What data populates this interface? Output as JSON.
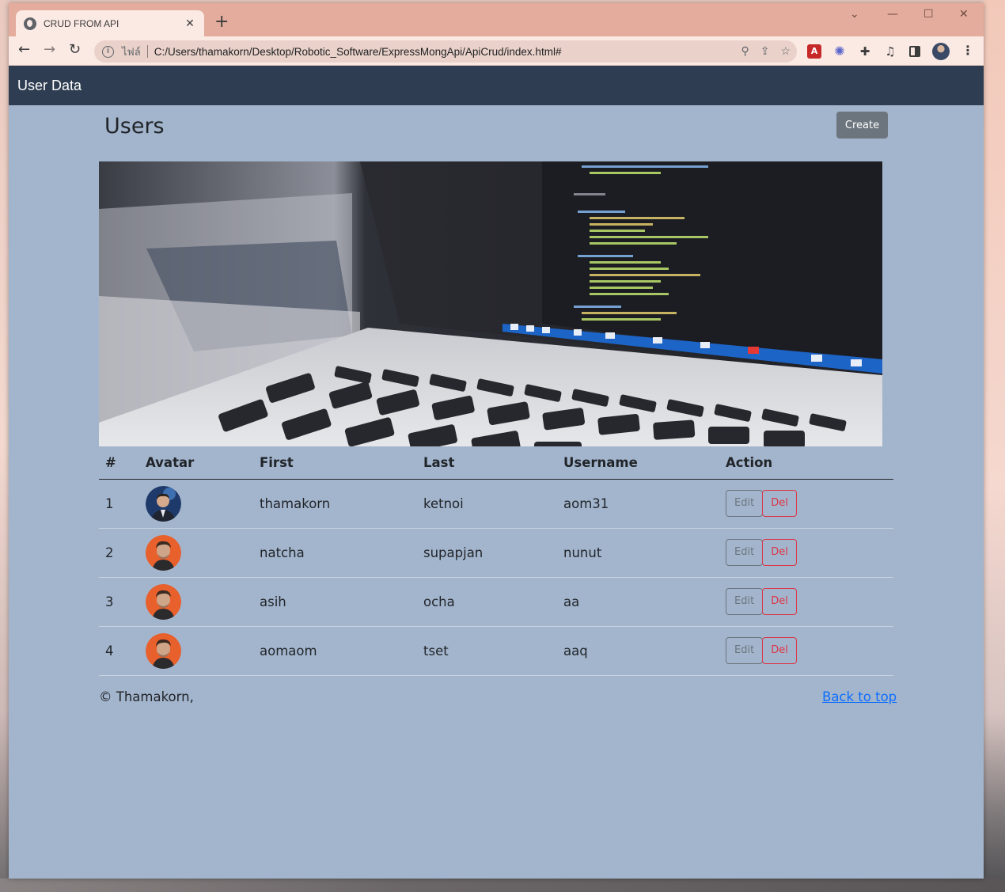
{
  "browser": {
    "tab_title": "CRUD FROM API",
    "new_tab": "+",
    "scheme_label": "ไฟล์",
    "url": "C:/Users/thamakorn/Desktop/Robotic_Software/ExpressMongApi/ApiCrud/index.html#"
  },
  "app": {
    "brand": "User Data",
    "page_title": "Users",
    "create_label": "Create"
  },
  "table": {
    "headers": [
      "#",
      "Avatar",
      "First",
      "Last",
      "Username",
      "Action"
    ],
    "rows": [
      {
        "num": "1",
        "first": "thamakorn",
        "last": "ketnoi",
        "username": "aom31",
        "avatar": "person-suit-avatar"
      },
      {
        "num": "2",
        "first": "natcha",
        "last": "supapjan",
        "username": "nunut",
        "avatar": "person-orange-avatar"
      },
      {
        "num": "3",
        "first": "asih",
        "last": "ocha",
        "username": "aa",
        "avatar": "person-orange-avatar"
      },
      {
        "num": "4",
        "first": "aomaom",
        "last": "tset",
        "username": "aaq",
        "avatar": "person-orange-avatar"
      }
    ],
    "edit_label": "Edit",
    "del_label": "Del"
  },
  "footer": {
    "copyright": "© Thamakorn,",
    "back_to_top": "Back to top"
  },
  "colors": {
    "navbar": "#2e3d51",
    "page_bg": "#a3b5cd",
    "secondary": "#6c757d",
    "danger": "#dc3545",
    "link": "#0d6efd"
  }
}
